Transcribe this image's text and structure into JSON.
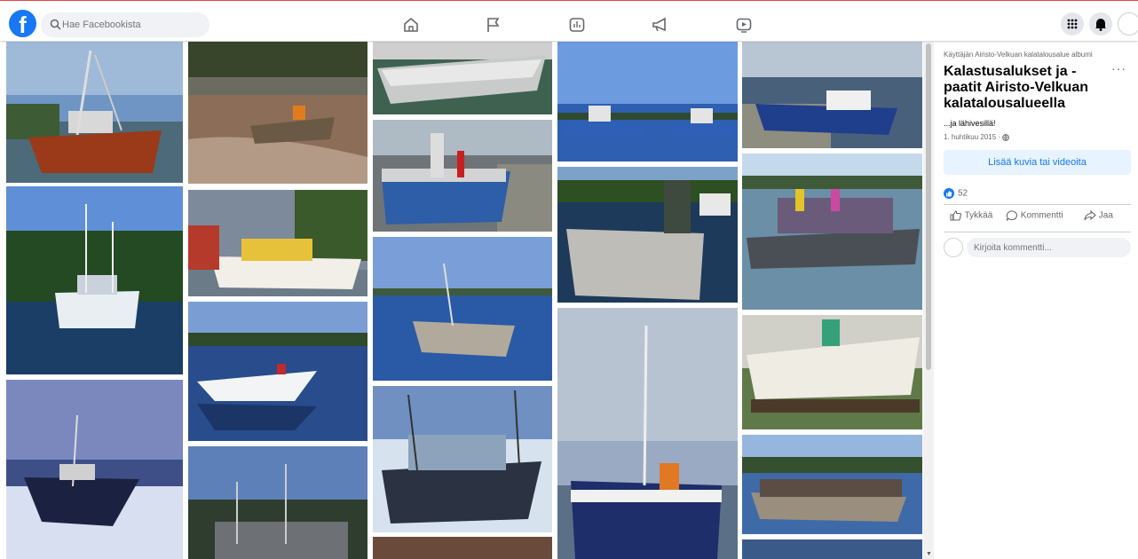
{
  "header": {
    "search_placeholder": "Hae Facebookista",
    "logo_letter": "f",
    "brand_color": "#1877f2"
  },
  "nav": [
    "home-icon",
    "flag-icon",
    "gaming-icon",
    "megaphone-icon",
    "video-icon"
  ],
  "right_icons": [
    "menu-grid-icon",
    "notifications-icon",
    "account-avatar"
  ],
  "gallery": {
    "photo_count": 22,
    "alt": "Kalastusalus"
  },
  "panel": {
    "breadcrumb": "Käyttäjän Airisto-Velkuan kalatalousalue albumi",
    "title": "Kalastusalukset ja -paatit Airisto-Velkuan kalatalousalueella",
    "more": "···",
    "description": "...ja lähivesillä!",
    "date": "1. huhtikuu 2015 · ",
    "add_button": "Lisää kuvia tai videoita",
    "like_count": "52",
    "like_action": "Tykkää",
    "comment_action": "Kommentti",
    "share_action": "Jaa",
    "comment_placeholder": "Kirjoita kommentti..."
  }
}
